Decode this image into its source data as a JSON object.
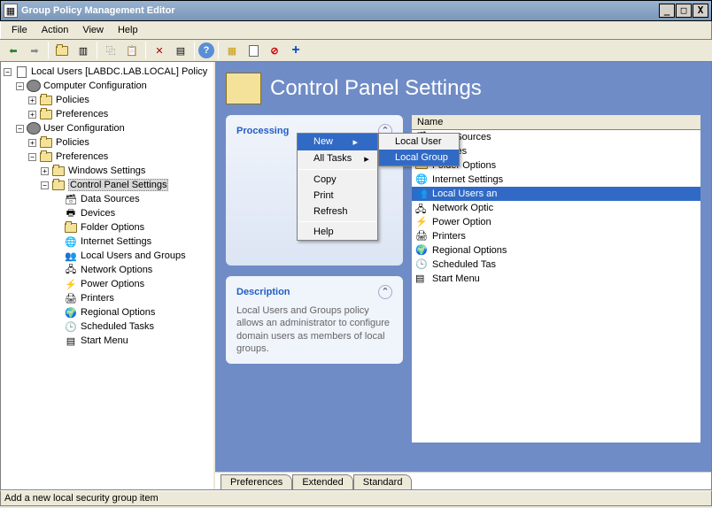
{
  "window": {
    "title": "Group Policy Management Editor"
  },
  "menubar": [
    "File",
    "Action",
    "View",
    "Help"
  ],
  "tree": {
    "root": "Local Users [LABDC.LAB.LOCAL] Policy",
    "computer": "Computer Configuration",
    "comp_pol": "Policies",
    "comp_pref": "Preferences",
    "user": "User Configuration",
    "user_pol": "Policies",
    "user_pref": "Preferences",
    "win_set": "Windows Settings",
    "cp_set": "Control Panel Settings",
    "items": [
      "Data Sources",
      "Devices",
      "Folder Options",
      "Internet Settings",
      "Local Users and Groups",
      "Network Options",
      "Power Options",
      "Printers",
      "Regional Options",
      "Scheduled Tasks",
      "Start Menu"
    ]
  },
  "main": {
    "title": "Control Panel Settings",
    "processing": "Processing",
    "description": "Description",
    "desc_text": "Local Users and Groups policy allows an administrator to configure domain users as members of local groups.",
    "name_col": "Name",
    "list": [
      "Data Sources",
      "Devices",
      "Folder Options",
      "Internet Settings",
      "Local Users and Groups",
      "Network Options",
      "Power Options",
      "Printers",
      "Regional Options",
      "Scheduled Tasks",
      "Start Menu"
    ]
  },
  "list_trunc": {
    "4": "Local Users an",
    "5": "Network Optic",
    "6": "Power Option",
    "9": "Scheduled Tas"
  },
  "ctx1": {
    "new": "New",
    "alltasks": "All Tasks",
    "copy": "Copy",
    "print": "Print",
    "refresh": "Refresh",
    "help": "Help"
  },
  "ctx2": {
    "localuser": "Local User",
    "localgroup": "Local Group"
  },
  "tabs": [
    "Preferences",
    "Extended",
    "Standard"
  ],
  "status": "Add a new local security group item"
}
